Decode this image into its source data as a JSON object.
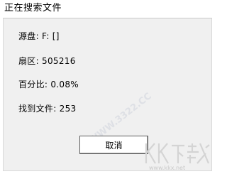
{
  "window": {
    "title": "正在搜索文件"
  },
  "info": {
    "source_disk": "源盘: F: []",
    "sector": "扇区: 505216",
    "percent": "百分比: 0.08%",
    "found_files": "找到文件: 253"
  },
  "buttons": {
    "cancel_label": "取消"
  },
  "watermark": {
    "logo_text": "KK下载",
    "url": "www.kkx.net",
    "diagonal_text": "WWW.3322.CC"
  },
  "colors": {
    "dialog_background": "#f0f0f0",
    "window_background": "#ffffff",
    "button_border": "#5c5c5c",
    "watermark": "#c9c9c9"
  }
}
